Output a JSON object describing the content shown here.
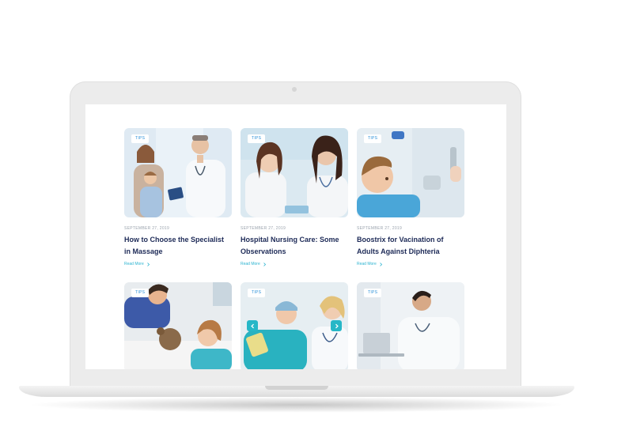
{
  "posts": [
    {
      "tag": "TIPS",
      "date": "SEPTEMBER 27, 2019",
      "title": "How to Choose the Specialist in Massage",
      "read_more": "Read More"
    },
    {
      "tag": "TIPS",
      "date": "SEPTEMBER 27, 2019",
      "title": "Hospital Nursing Care: Some Observations",
      "read_more": "Read More"
    },
    {
      "tag": "TIPS",
      "date": "SEPTEMBER 27, 2019",
      "title": "Boostrix for Vacination of Adults Against Diphteria",
      "read_more": "Read More"
    },
    {
      "tag": "TIPS"
    },
    {
      "tag": "TIPS"
    },
    {
      "tag": "TIPS"
    }
  ],
  "colors": {
    "title": "#1d2a57",
    "read_more": "#2bb3d0",
    "tag_text": "#2a8fd8",
    "slider_arrow": "#26b7c7"
  },
  "icons": {
    "read_more": "chevron-right-icon",
    "slider_prev": "chevron-left-icon",
    "slider_next": "chevron-right-icon"
  }
}
